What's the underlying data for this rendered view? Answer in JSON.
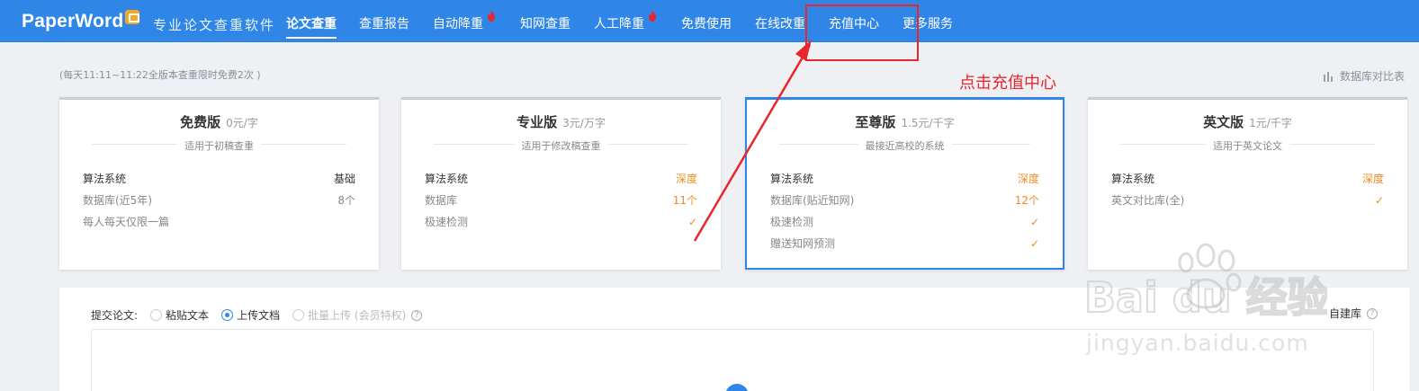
{
  "brand": {
    "logo": "PaperWord",
    "slogan": "专业论文查重软件"
  },
  "nav": {
    "items": [
      {
        "label": "论文查重",
        "active": true
      },
      {
        "label": "查重报告"
      },
      {
        "label": "自动降重",
        "hot": true
      },
      {
        "label": "知网查重"
      },
      {
        "label": "人工降重",
        "hot": true
      },
      {
        "label": "免费使用"
      },
      {
        "label": "在线改重"
      },
      {
        "label": "充值中心"
      },
      {
        "label": "更多服务"
      }
    ]
  },
  "hint": "(每天11:11~11:22全版本查重限时免费2次 )",
  "compare_link": "数据库对比表",
  "plans": [
    {
      "name": "免费版",
      "price": "0元/字",
      "subtitle": "适用于初稿查重",
      "rows": [
        {
          "label": "算法系统",
          "value": "基础"
        },
        {
          "label": "数据库(近5年)",
          "value": "8个"
        },
        {
          "label": "每人每天仅限一篇",
          "value": ""
        }
      ]
    },
    {
      "name": "专业版",
      "price": "3元/万字",
      "subtitle": "适用于修改稿查重",
      "rows": [
        {
          "label": "算法系统",
          "value": "深度"
        },
        {
          "label": "数据库",
          "value": "11个"
        },
        {
          "label": "极速检测",
          "value": "✓"
        }
      ]
    },
    {
      "name": "至尊版",
      "price": "1.5元/千字",
      "subtitle": "最接近高校的系统",
      "rows": [
        {
          "label": "算法系统",
          "value": "深度"
        },
        {
          "label": "数据库(贴近知网)",
          "value": "12个"
        },
        {
          "label": "极速检测",
          "value": "✓"
        },
        {
          "label": "赠送知网预测",
          "value": "✓"
        }
      ]
    },
    {
      "name": "英文版",
      "price": "1元/千字",
      "subtitle": "适用于英文论文",
      "rows": [
        {
          "label": "算法系统",
          "value": "深度"
        },
        {
          "label": "英文对比库(全)",
          "value": "✓"
        }
      ]
    }
  ],
  "submit": {
    "label": "提交论文:",
    "options": [
      "粘贴文本",
      "上传文档",
      "批量上传 (会员特权)"
    ],
    "selected": "上传文档",
    "own_library": "自建库"
  },
  "annotation": "点击充值中心",
  "watermark": {
    "logo": "Bai du 经验",
    "url": "jingyan.baidu.com"
  },
  "colors": {
    "primary": "#2f86e6",
    "accent_orange": "#f08a24",
    "annotation_red": "#e8262b"
  }
}
